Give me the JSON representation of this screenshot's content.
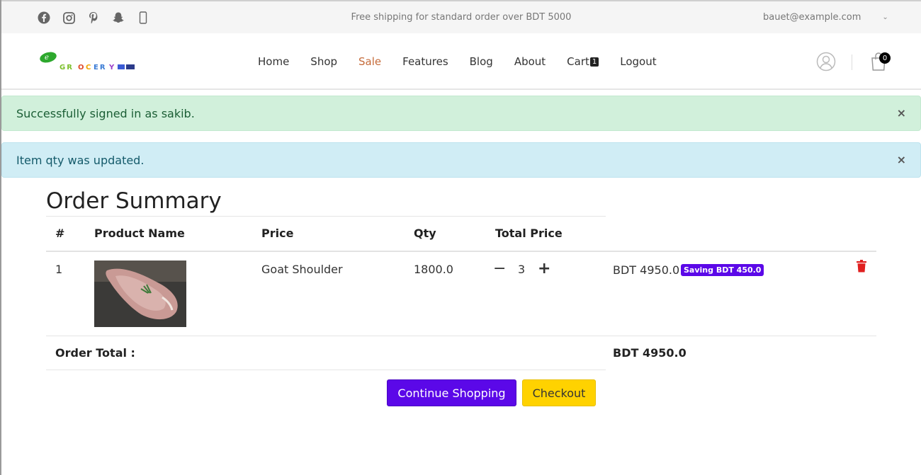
{
  "topbar": {
    "social_icons": [
      "facebook-icon",
      "instagram-icon",
      "pinterest-icon",
      "snapchat-icon",
      "mobile-icon"
    ],
    "promo_text": "Free shipping for standard order over BDT 5000",
    "account_email": "bauet@example.com"
  },
  "header": {
    "logo_text": "GROCERY",
    "nav": [
      {
        "label": "Home"
      },
      {
        "label": "Shop"
      },
      {
        "label": "Sale"
      },
      {
        "label": "Features"
      },
      {
        "label": "Blog"
      },
      {
        "label": "About"
      },
      {
        "label": "Cart",
        "count": "1"
      },
      {
        "label": "Logout"
      }
    ],
    "bag_count": "0",
    "accent_color": "#c56b3a"
  },
  "alerts": {
    "success": {
      "text": "Successfully signed in as sakib.",
      "close": "×"
    },
    "info": {
      "text": "Item qty was updated.",
      "close": "×"
    }
  },
  "order": {
    "title": "Order Summary",
    "columns": [
      "#",
      "Product Name",
      "Price",
      "Qty",
      "Total Price"
    ],
    "rows": [
      {
        "index": "1",
        "name": "Goat Shoulder",
        "price": "1800.0",
        "qty": "3",
        "total": "BDT 4950.0",
        "saving": "Saving BDT 450.0"
      }
    ],
    "total_label": "Order Total :",
    "total_value": "BDT 4950.0"
  },
  "buttons": {
    "continue": "Continue Shopping",
    "checkout": "Checkout",
    "continue_color": "#5b08e8",
    "checkout_color": "#ffd200"
  }
}
